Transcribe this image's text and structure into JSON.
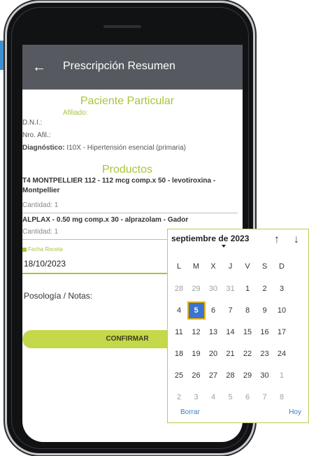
{
  "appbar": {
    "title": "Prescripción Resumen",
    "back_icon": "arrow-left-icon"
  },
  "patient": {
    "section_title": "Paciente Particular",
    "affiliate_label": "Afiliado:",
    "dni_label": "D.N.I.:",
    "afil_label": "Nro. Afil.:",
    "diagnosis_label": "Diagnóstico:",
    "diagnosis_value": "I10X - Hipertensión esencial (primaria)"
  },
  "products": {
    "section_title": "Productos",
    "items": [
      {
        "name": "T4 MONTPELLIER 112 - 112 mcg comp.x 50 - levotiroxina - Montpellier",
        "qty": "Cantidad: 1"
      },
      {
        "name": "ALPLAX - 0.50 mg comp.x 30 - alprazolam - Gador",
        "qty": "Cantidad: 1"
      }
    ]
  },
  "recipe": {
    "date_label": "Fecha Receta",
    "date_value": "18/10/2023"
  },
  "notes": {
    "label": "Posología / Notas:"
  },
  "confirm_label": "CONFIRMAR",
  "picker": {
    "month": "septiembre de 2023",
    "weekdays": [
      "L",
      "M",
      "X",
      "J",
      "V",
      "S",
      "D"
    ],
    "weeks": [
      [
        "28",
        "29",
        "30",
        "31",
        "1",
        "2",
        "3"
      ],
      [
        "4",
        "5",
        "6",
        "7",
        "8",
        "9",
        "10"
      ],
      [
        "11",
        "12",
        "13",
        "14",
        "15",
        "16",
        "17"
      ],
      [
        "18",
        "19",
        "20",
        "21",
        "22",
        "23",
        "24"
      ],
      [
        "25",
        "26",
        "27",
        "28",
        "29",
        "30",
        "1"
      ],
      [
        "2",
        "3",
        "4",
        "5",
        "6",
        "7",
        "8"
      ]
    ],
    "selected_day": "5",
    "clear_label": "Borrar",
    "today_label": "Hoy"
  },
  "colors": {
    "accent_green": "#a6c63b",
    "appbar": "#565a60",
    "select_blue": "#3b73d1",
    "link_blue": "#3d7bd2"
  }
}
